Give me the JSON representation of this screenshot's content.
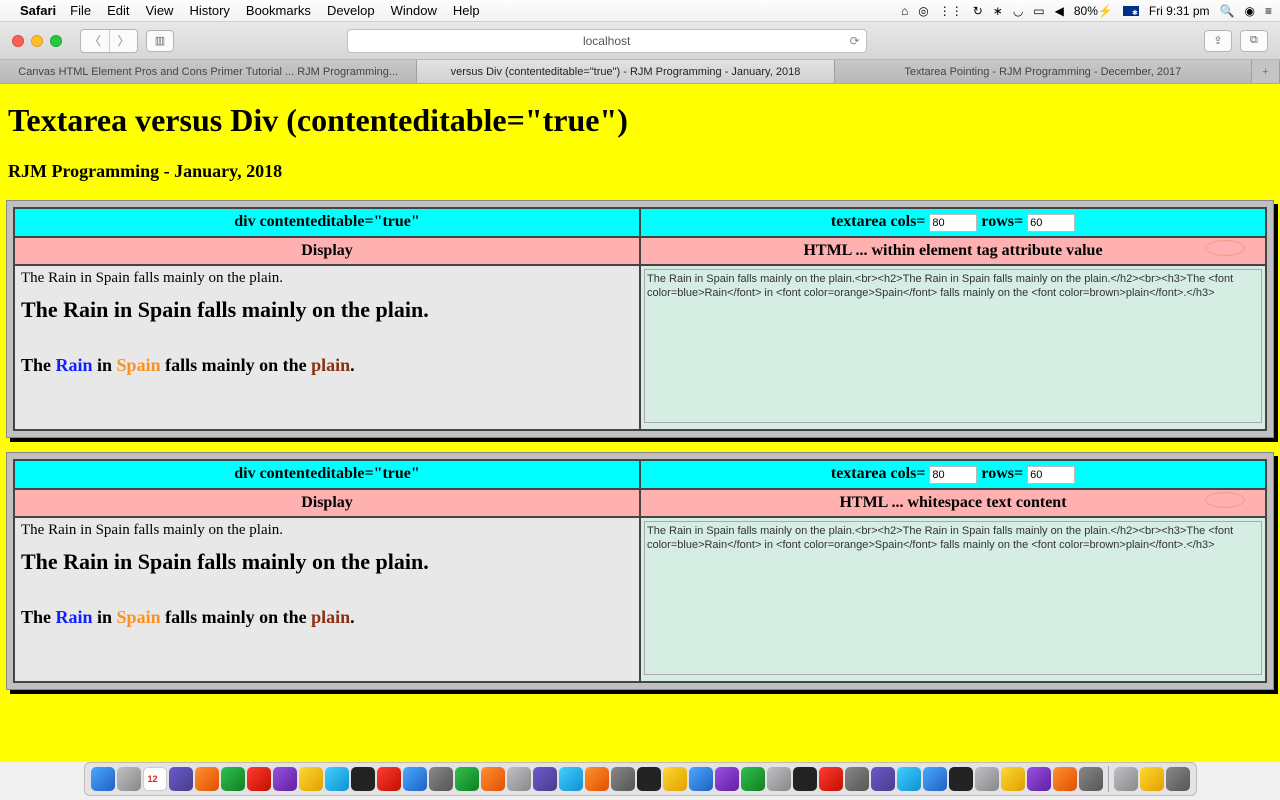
{
  "menubar": {
    "app": "Safari",
    "items": [
      "File",
      "Edit",
      "View",
      "History",
      "Bookmarks",
      "Develop",
      "Window",
      "Help"
    ],
    "battery": "80%",
    "clock": "Fri 9:31 pm"
  },
  "toolbar": {
    "url_display": "localhost"
  },
  "browser_tabs": {
    "tabs": [
      "Canvas HTML Element Pros and Cons Primer Tutorial ... RJM Programming...",
      "versus Div (contenteditable=\"true\") - RJM Programming - January, 2018",
      "Textarea Pointing - RJM Programming - December, 2017"
    ],
    "active_index": 1
  },
  "page": {
    "title": "Textarea versus Div (contenteditable=\"true\")",
    "subtitle": "RJM Programming - January, 2018",
    "col_left_header": "div contenteditable=\"true\"",
    "col_right_header_prefix": "textarea cols=",
    "col_right_header_rows": "rows=",
    "cols_value": "80",
    "rows_value": "60",
    "sub_left": "Display",
    "sub_right_1": "HTML ... within element tag attribute value",
    "sub_right_2": "HTML ... whitespace text content",
    "body_line1": "The Rain in Spain falls mainly on the plain.",
    "body_line2": "The Rain in Spain falls mainly on the plain.",
    "body3_pre": "The ",
    "body3_rain": "Rain",
    "body3_in": " in ",
    "body3_spain": "Spain",
    "body3_mid": " falls mainly on the ",
    "body3_plain": "plain",
    "body3_dot": ".",
    "textarea_html": "The Rain in Spain falls mainly on the plain.<br><h2>The Rain in Spain falls mainly on the plain.</h2><br><h3>The <font color=blue>Rain</font> in <font color=orange>Spain</font> falls mainly on the <font color=brown>plain</font>.</h3>"
  }
}
